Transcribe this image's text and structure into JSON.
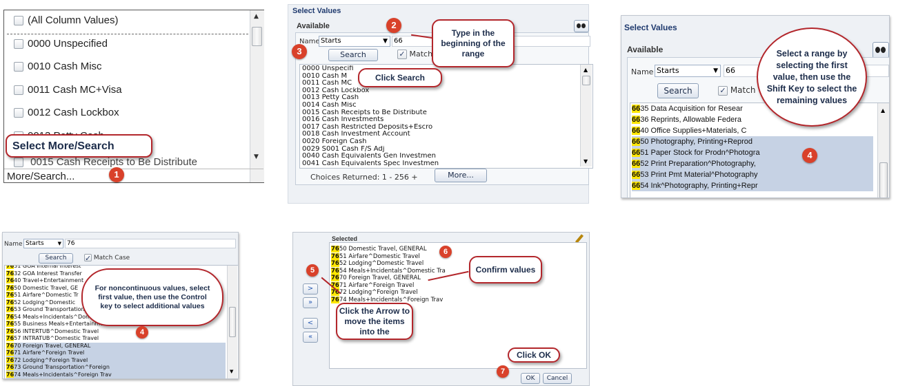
{
  "panel1": {
    "items": [
      "(All Column Values)",
      "0000 Unspecified",
      "0010 Cash Misc",
      "0011 Cash MC+Visa",
      "0012 Cash Lockbox",
      "0013 Petty Cash"
    ],
    "partial_item": "0015 Cash Receipts to Be Distribute",
    "select_more_label": "Select More/Search",
    "footer": "More/Search...",
    "step": "1"
  },
  "panel2": {
    "title": "Select Values",
    "available": "Available",
    "name_label": "Name",
    "operator": "Starts",
    "search_value": "66",
    "search_btn": "Search",
    "match_label": "Match",
    "list": [
      "0000 Unspecifi",
      "0010 Cash M",
      "0011 Cash MC",
      "0012 Cash Lockbox",
      "0013 Petty Cash",
      "0014 Cash Misc",
      "0015 Cash Receipts to Be Distribute",
      "0016 Cash Investments",
      "0017 Cash Restricted Deposits+Escro",
      "0018 Cash Investment Account",
      "0020 Foreign Cash",
      "0029 S001 Cash F/S Adj",
      "0040 Cash Equivalents Gen Investmen",
      "0041 Cash Equivalents Spec Investmen"
    ],
    "choices": "Choices Returned: 1 - 256 +",
    "more_btn": "More...",
    "callout_type": "Type in the beginning of the range",
    "callout_search": "Click Search",
    "step2": "2",
    "step3": "3"
  },
  "panel3": {
    "title": "Select Values",
    "available": "Available",
    "name_label": "Name",
    "operator": "Starts",
    "search_value": "66",
    "search_btn": "Search",
    "match_label": "Match",
    "rows": [
      {
        "hl": "66",
        "rest": "35 Data Acquisition for Resear"
      },
      {
        "hl": "66",
        "rest": "36 Reprints, Allowable Federa"
      },
      {
        "hl": "66",
        "rest": "40 Office Supplies+Materials, C"
      },
      {
        "hl": "66",
        "rest": "50 Photography, Printing+Reprod"
      },
      {
        "hl": "66",
        "rest": "51 Paper Stock for Prodn^Photogra"
      },
      {
        "hl": "66",
        "rest": "52 Print Preparation^Photography,"
      },
      {
        "hl": "66",
        "rest": "53 Print Pmt Material^Photography"
      },
      {
        "hl": "66",
        "rest": "54 Ink^Photography, Printing+Repr"
      }
    ],
    "callout": "Select a range by selecting the first value, then use the Shift Key to select the remaining values",
    "step": "4"
  },
  "panel4": {
    "name_label": "Name",
    "operator": "Starts",
    "search_value": "76",
    "search_btn": "Search",
    "match_label": "Match Case",
    "rows": [
      {
        "hl": "76",
        "rest": "31 GOA Internal Interest"
      },
      {
        "hl": "76",
        "rest": "32 GOA Interest Transfer"
      },
      {
        "hl": "76",
        "rest": "40 Travel+Entertainment"
      },
      {
        "hl": "76",
        "rest": "50 Domestic Travel, GE"
      },
      {
        "hl": "76",
        "rest": "51 Airfare^Domestic Tr"
      },
      {
        "hl": "76",
        "rest": "52 Lodging^Domestic"
      },
      {
        "hl": "76",
        "rest": "53 Ground Transportation"
      },
      {
        "hl": "76",
        "rest": "54 Meals+Incidentals^Domestic"
      },
      {
        "hl": "76",
        "rest": "55 Business Meals+Entertainment,"
      },
      {
        "hl": "76",
        "rest": "56 INTERTUB^Domestic Travel"
      },
      {
        "hl": "76",
        "rest": "57 INTRATUB^Domestic Travel"
      },
      {
        "hl": "76",
        "rest": "70 Foreign Travel, GENERAL"
      },
      {
        "hl": "76",
        "rest": "71 Airfare^Foreign Travel"
      },
      {
        "hl": "76",
        "rest": "72 Lodging^Foreign Travel"
      },
      {
        "hl": "76",
        "rest": "73 Ground Transportation^Foreign"
      },
      {
        "hl": "76",
        "rest": "74 Meals+Incidentals^Foreign Trav"
      }
    ],
    "callout": "For noncontinuous values, select first value, then use the Control key to select additional values",
    "step": "4"
  },
  "panel5": {
    "selected_label": "Selected",
    "rows": [
      {
        "hl": "76",
        "rest": "50 Domestic Travel, GENERAL"
      },
      {
        "hl": "76",
        "rest": "51 Airfare^Domestic Travel"
      },
      {
        "hl": "76",
        "rest": "52 Lodging^Domestic Travel"
      },
      {
        "hl": "76",
        "rest": "54 Meals+Incidentals^Domestic Tra"
      },
      {
        "hl": "76",
        "rest": "70 Foreign Travel, GENERAL"
      },
      {
        "hl": "76",
        "rest": "71 Airfare^Foreign Travel"
      },
      {
        "hl": "76",
        "rest": "72 Lodging^Foreign Travel"
      },
      {
        "hl": "76",
        "rest": "74 Meals+Incidentals^Foreign Trav"
      }
    ],
    "callout_confirm": "Confirm values",
    "callout_arrow": "Click the Arrow to move the items into the",
    "callout_ok": "Click OK",
    "ok_btn": "OK",
    "cancel_btn": "Cancel",
    "step5": "5",
    "step6": "6",
    "step7": "7"
  },
  "colors": {
    "accent": "#b3262b",
    "badge": "#d9412a",
    "highlight": "#ffe600",
    "selection": "#c6d2e4",
    "title": "#1f3a6e"
  }
}
